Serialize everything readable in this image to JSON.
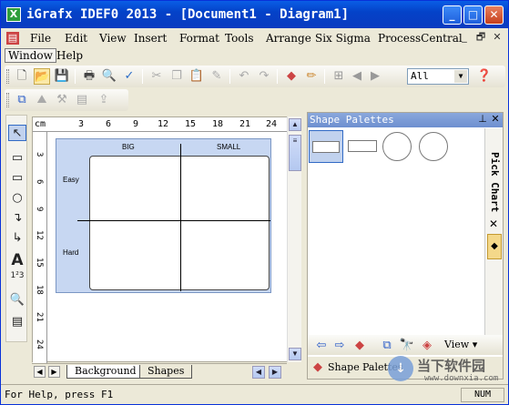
{
  "titlebar": {
    "app_icon": "igrafx-icon",
    "title": "iGrafx IDEF0 2013 - [Document1 - Diagram1]",
    "buttons": [
      "_",
      "□",
      "✕"
    ]
  },
  "menu": {
    "items": [
      "File",
      "Edit",
      "View",
      "Insert",
      "Format",
      "Tools",
      "Arrange",
      "Six Sigma",
      "ProcessCentral"
    ],
    "mdi_buttons": [
      "_",
      "🗗",
      "✕"
    ]
  },
  "menu2": {
    "items": [
      "Window",
      "Help"
    ]
  },
  "toolbar1": {
    "icons": [
      "new-icon",
      "open-icon",
      "save-icon",
      "print-icon",
      "print-preview-icon",
      "spell-check-icon",
      "cut-icon",
      "copy-icon",
      "paste-icon",
      "format-painter-icon",
      "undo-icon",
      "redo-icon",
      "shapes-icon",
      "pen-icon",
      "node-icon",
      "back-icon",
      "forward-icon",
      "help-icon"
    ],
    "zoom_value": "All"
  },
  "toolbar2": {
    "icons": [
      "diagram-icon",
      "picture-icon",
      "tool-icon",
      "table-icon",
      "export-icon"
    ]
  },
  "lefttools": {
    "icons": [
      "pointer-icon",
      "shape-tool-icon",
      "rectangle-icon",
      "ellipse-icon",
      "connector-icon",
      "connector2-icon",
      "text-tool-icon",
      "numbering-icon",
      "zoom-icon",
      "note-icon"
    ]
  },
  "ruler": {
    "unit": "cm",
    "h_labels": [
      "3",
      "6",
      "9",
      "12",
      "15",
      "18",
      "21",
      "24"
    ],
    "v_labels": [
      "3",
      "6",
      "9",
      "12",
      "15",
      "18",
      "21",
      "24"
    ]
  },
  "diagram": {
    "col_big": "BIG",
    "col_small": "SMALL",
    "row_easy": "Easy",
    "row_hard": "Hard"
  },
  "tabs": {
    "items": [
      "Background",
      "Shapes"
    ]
  },
  "rightpane": {
    "title": "Shape Palettes",
    "pin": "⊥",
    "close": "✕",
    "pick_chart": "Pick Chart",
    "pick_close": "✕",
    "view_label": "View ▾",
    "tab1": "Shape",
    "tab2": "Palettes"
  },
  "status": {
    "text": "For Help, press F1",
    "num": "NUM"
  },
  "watermark": {
    "text": "当下软件园",
    "url": "www.downxia.com"
  }
}
